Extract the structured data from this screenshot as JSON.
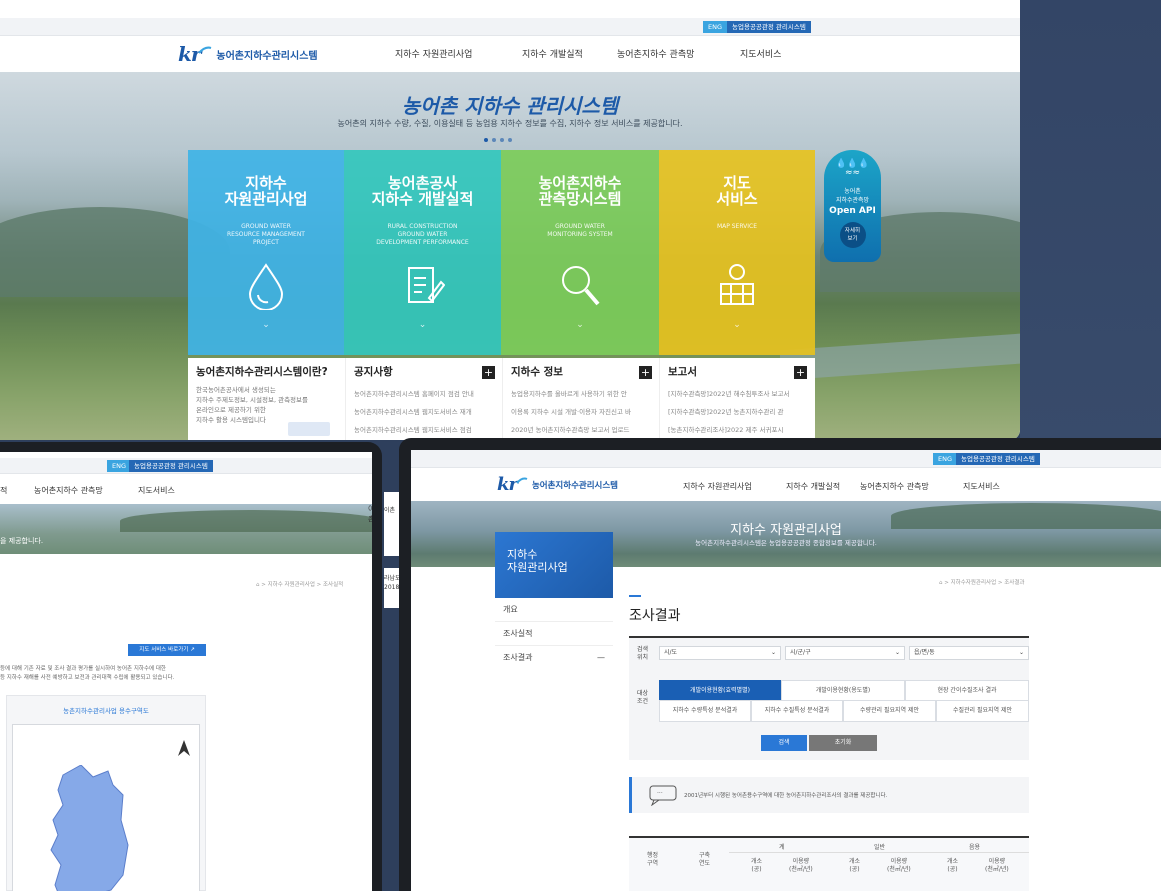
{
  "site": {
    "brand": "kr",
    "name": "농어촌지하수관리시스템",
    "lang": "ENG",
    "sister": "농업용공공관정 관리시스템",
    "sister2": "농업용공공관정 관리시스템"
  },
  "nav": [
    "지하수 자원관리사업",
    "지하수 개발실적",
    "농어촌지하수 관측망",
    "지도서비스"
  ],
  "hero": {
    "title": "농어촌 지하수 관리시스템",
    "subtitle": "농어촌의 지하수 수량, 수질, 이용실태 등 농업용 지하수 정보를 수집, 지하수 정보 서비스를 제공합니다.",
    "cards": [
      {
        "title_1": "지하수",
        "title_2": "자원관리사업",
        "sub_1": "GROUND WATER",
        "sub_2": "RESOURCE MANAGEMENT",
        "sub_3": "PROJECT",
        "color": "#3fb3e6"
      },
      {
        "title_1": "농어촌공사",
        "title_2": "지하수 개발실적",
        "sub_1": "RURAL CONSTRUCTION",
        "sub_2": "GROUND WATER",
        "sub_3": "DEVELOPMENT PERFORMANCE",
        "color": "#33c7bd"
      },
      {
        "title_1": "농어촌지하수",
        "title_2": "관측망시스템",
        "sub_1": "GROUND WATER",
        "sub_2": "MONITORING SYSTEM",
        "sub_3": "",
        "color": "#7ccc5a"
      },
      {
        "title_1": "지도",
        "title_2": "서비스",
        "sub_1": "MAP SERVICE",
        "sub_2": "",
        "sub_3": "",
        "color": "#e6c21f"
      }
    ],
    "api": {
      "line1": "농어촌",
      "line2": "지하수관측망",
      "line3": "Open API",
      "more_1": "자세히",
      "more_2": "보기"
    }
  },
  "panels": {
    "about": {
      "title": "농어촌지하수관리시스템이란?",
      "l1": "한국농어촌공사에서 생성되는",
      "l2": "지하수 주제도정보, 시설정보, 관측정보를",
      "l3": "온라인으로 제공하기 위한",
      "l4": "지하수 활용 시스템입니다"
    },
    "notice": {
      "title": "공지사항",
      "items": [
        "농어촌지하수관리시스템 홈페이지 점검 안내",
        "농어촌지하수관리시스템 웹지도서비스 재개",
        "농어촌지하수관리시스템 웹지도서비스 점검"
      ]
    },
    "info": {
      "title": "지하수 정보",
      "items": [
        "농업용지하수를 올바르게 사용하기 위한 안",
        "이용록 지하수 시설 개발·이용자 자진신고 바",
        "2020년 농어촌지하수관측망 보고서 업로드"
      ]
    },
    "report": {
      "title": "보고서",
      "items": [
        "[지하수관측망]2022년 해수침투조사 보고서",
        "[지하수관측망]2022년 농촌지하수관리 관",
        "[농촌지하수관리조사]2022 제주 서귀포시"
      ]
    }
  },
  "left_window": {
    "nav": [
      "적",
      "농어촌지하수 관측망",
      "지도서비스"
    ],
    "hero_text": "을 제공합니다.",
    "breadcrumb": "⌂ > 지하수 자원관리사업 > 조사실적",
    "map_button": "지도 서비스 바로가기 ↗",
    "desc_1": "등에 대해 기존 자료 및 조사 결과 평가를 실시하여 농어촌 지하수에 대한",
    "desc_2": "등 지하수 재해를 사전 예방하고 보전과 관리대책 수립에 활용되고 있습니다.",
    "map_title": "농촌지하수관리사업 용수구역도",
    "peek_1": "이촌",
    "peek_2": "라남도",
    "peek_3": "2018K"
  },
  "right_window": {
    "hero_title": "지하수 자원관리사업",
    "hero_sub": "농어촌지하수관리시스템은 농업용공공관정 종합정보를 제공합니다.",
    "side_title_1": "지하수",
    "side_title_2": "자원관리사업",
    "side_items": [
      {
        "label": "개요",
        "active": false
      },
      {
        "label": "조사실적",
        "active": false
      },
      {
        "label": "조사결과",
        "active": true
      }
    ],
    "collapse": "—",
    "breadcrumb": "⌂ > 지하수자원관리사업 > 조사결과",
    "page_title": "조사결과",
    "search_label_1": "검색",
    "search_label_2": "위치",
    "selects": [
      "시/도",
      "시/군/구",
      "읍/면/동"
    ],
    "cond_label_1": "대상",
    "cond_label_2": "조건",
    "tabs_row1": [
      {
        "label": "개발이용현황(효력별별)",
        "active": true
      },
      {
        "label": "개발이용현황(용도별)",
        "active": false
      },
      {
        "label": "현장 간이수질조사 결과",
        "active": false
      }
    ],
    "tabs_row2": [
      "지하수 수량특성 분석결과",
      "지하수 수질특성 분석결과",
      "수량관리 필요지역 제안",
      "수질관리 필요지역 제안"
    ],
    "search_btn": "검색",
    "reset_btn": "초기화",
    "notice": "2001년부터 시행된 농어촌용수구역에 대한 농어촌지하수관리조사의 결과를 제공합니다.",
    "table": {
      "c1_1": "행정",
      "c1_2": "구역",
      "c2_1": "구축",
      "c2_2": "연도",
      "g1": "계",
      "g2": "일반",
      "g3": "음용",
      "count": "개소",
      "count_u": "(공)",
      "use": "이용량",
      "use_u": "(천㎥/년)"
    }
  },
  "colors": {
    "primary": "#1d5aa8",
    "accent": "#2a78d6",
    "active_tab": "#1a5fb4",
    "reset": "#777777"
  }
}
